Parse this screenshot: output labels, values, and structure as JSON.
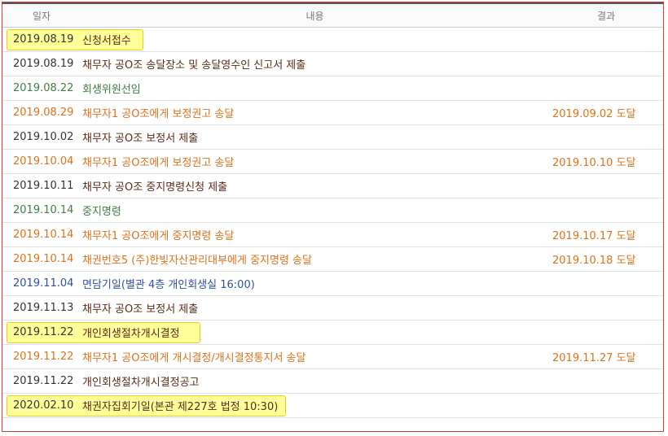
{
  "header": {
    "date": "일자",
    "content": "내용",
    "result": "결과"
  },
  "rows": [
    {
      "date": "2019.08.19",
      "content": "신청서접수",
      "result": "",
      "color": "black"
    },
    {
      "date": "2019.08.19",
      "content": "채무자 공O조 송달장소 및 송달영수인 신고서 제출",
      "result": "",
      "color": "black"
    },
    {
      "date": "2019.08.22",
      "content": "회생위원선임",
      "result": "",
      "color": "green"
    },
    {
      "date": "2019.08.29",
      "content": "채무자1 공O조에게 보정권고 송달",
      "result": "2019.09.02 도달",
      "color": "orange"
    },
    {
      "date": "2019.10.02",
      "content": "채무자 공O조 보정서 제출",
      "result": "",
      "color": "black"
    },
    {
      "date": "2019.10.04",
      "content": "채무자1 공O조에게 보정권고 송달",
      "result": "2019.10.10 도달",
      "color": "orange"
    },
    {
      "date": "2019.10.11",
      "content": "채무자 공O조 중지명령신청 제출",
      "result": "",
      "color": "black"
    },
    {
      "date": "2019.10.14",
      "content": "중지명령",
      "result": "",
      "color": "green"
    },
    {
      "date": "2019.10.14",
      "content": "채무자1 공O조에게 중지명령 송달",
      "result": "2019.10.17 도달",
      "color": "orange"
    },
    {
      "date": "2019.10.14",
      "content": "채권번호5 (주)한빛자산관리대부에게 중지명령 송달",
      "result": "2019.10.18 도달",
      "color": "orange"
    },
    {
      "date": "2019.11.04",
      "content": "면담기일(별관 4층 개인회생실 16:00)",
      "result": "",
      "color": "blue"
    },
    {
      "date": "2019.11.13",
      "content": "채무자 공O조 보정서 제출",
      "result": "",
      "color": "black"
    },
    {
      "date": "2019.11.22",
      "content": "개인회생절차개시결정",
      "result": "",
      "color": "black"
    },
    {
      "date": "2019.11.22",
      "content": "채무자1 공O조에게 개시결정/개시결정통지서 송달",
      "result": "2019.11.27 도달",
      "color": "orange"
    },
    {
      "date": "2019.11.22",
      "content": "개인회생절차개시결정공고",
      "result": "",
      "color": "black"
    },
    {
      "date": "2020.02.10",
      "content": "채권자집회기일(본관 제227호 법정 10:30)",
      "result": "",
      "color": "black"
    }
  ]
}
